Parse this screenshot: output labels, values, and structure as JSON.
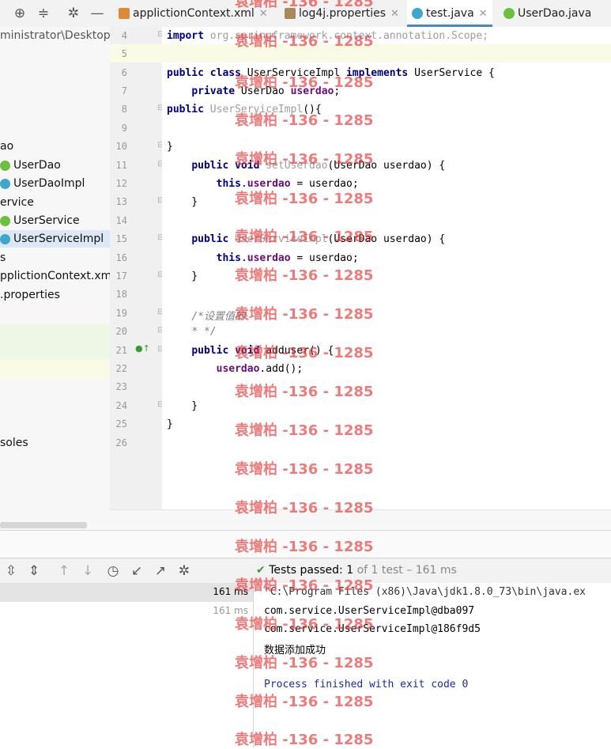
{
  "tabs": [
    {
      "label": "applictionContext.xml",
      "icon": "xml-file-icon"
    },
    {
      "label": "log4j.properties",
      "icon": "properties-file-icon"
    },
    {
      "label": "test.java",
      "icon": "java-class-icon"
    },
    {
      "label": "UserDao.java",
      "icon": "java-interface-icon"
    }
  ],
  "project": {
    "path": "ministrator\\Desktop\\c",
    "items": [
      "ao",
      "UserDao",
      "UserDaoImpl",
      "ervice",
      "UserService",
      "UserServiceImpl",
      "s",
      "pplictionContext.xml",
      ".properties",
      "soles"
    ]
  },
  "editor": {
    "line_numbers": [
      "4",
      "5",
      "6",
      "7",
      "8",
      "9",
      "10",
      "11",
      "12",
      "13",
      "14",
      "15",
      "16",
      "17",
      "18",
      "19",
      "20",
      "21",
      "22",
      "23",
      "24",
      "25",
      "26"
    ]
  },
  "bottom": {
    "tests_passed_label": "Tests passed:",
    "tests_passed_count": "1",
    "tests_total": "of 1 test – 161 ms",
    "row_time_1": "161 ms",
    "row_time_2": "161 ms"
  },
  "console": {
    "lines": [
      "\"C:\\Program Files (x86)\\Java\\jdk1.8.0_73\\bin\\java.ex",
      "com.service.UserServiceImpl@dba097",
      "com.service.UserServiceImpl@186f9d5",
      "数据添加成功",
      "",
      "Process finished with exit code 0"
    ]
  },
  "watermark": "袁增柏 -136 - 1285",
  "colors": {
    "keyword": "#000080",
    "field": "#660e7a",
    "accent": "#4a86c8",
    "pass": "#3a9a3a"
  }
}
